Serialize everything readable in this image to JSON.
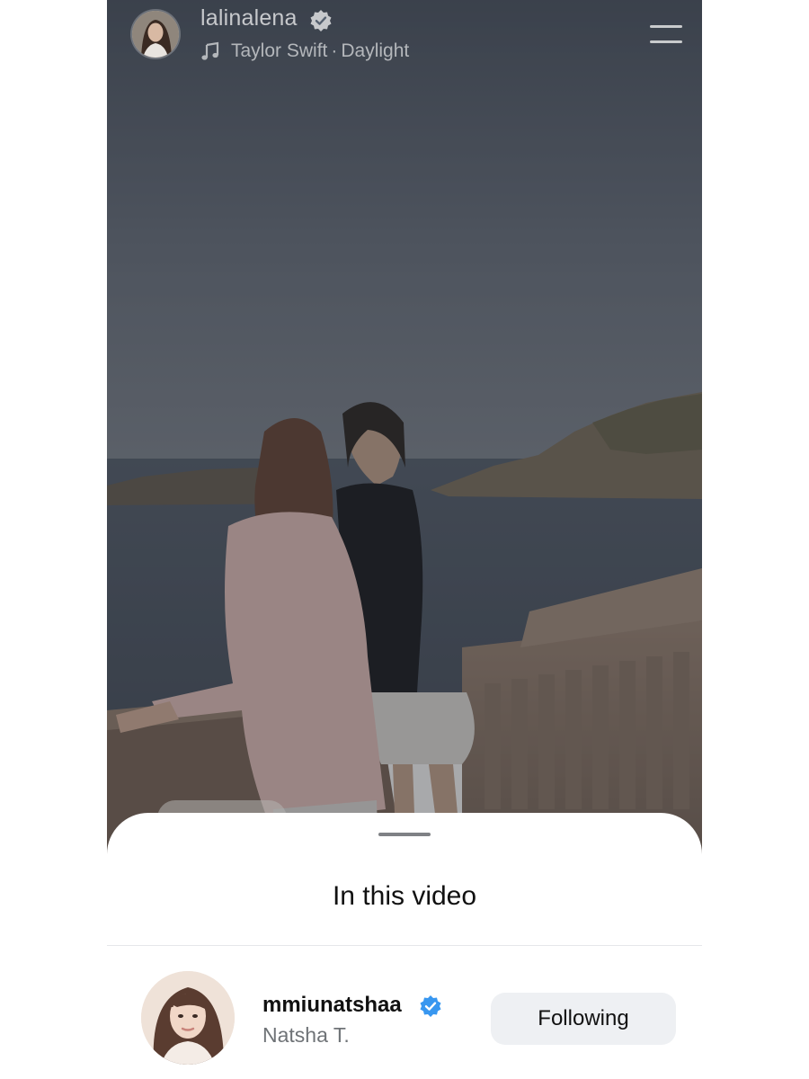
{
  "post": {
    "username": "lalinalena",
    "verified": true,
    "music": {
      "icon": "music-note-icon",
      "artist": "Taylor Swift",
      "separator": "·",
      "track": "Daylight"
    },
    "menu_icon": "menu-lines-icon"
  },
  "sheet": {
    "title": "In this video",
    "users": [
      {
        "handle": "mmiunatshaa",
        "verified": true,
        "name": "Natsha T.",
        "button_label": "Following"
      }
    ]
  },
  "colors": {
    "verified_blue": "#3897f0",
    "sky": "#5b6573",
    "sea": "#4a5563",
    "sheet_background": "#ffffff",
    "button_background": "#eef0f3"
  }
}
